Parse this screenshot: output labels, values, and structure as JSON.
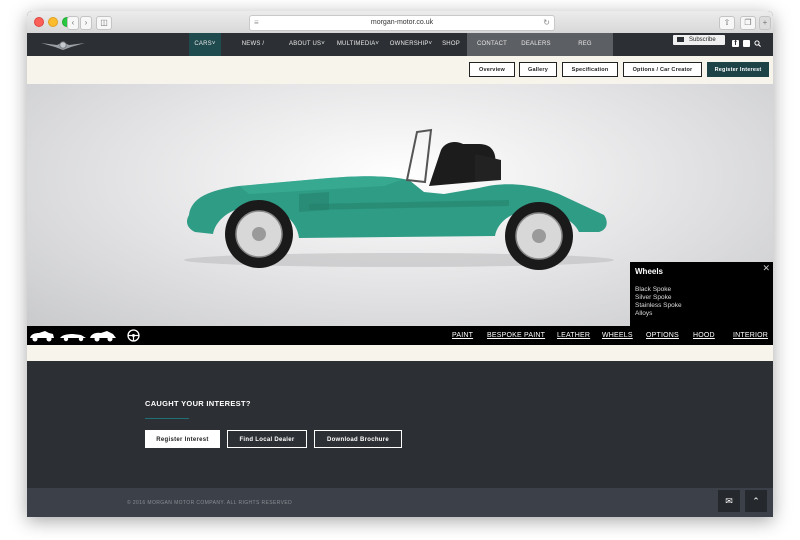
{
  "browser": {
    "url": "morgan-motor.co.uk"
  },
  "nav": {
    "items": [
      "CARS",
      "NEWS / EVENTS",
      "ABOUT US",
      "MULTIMEDIA",
      "OWNERSHIP",
      "SHOP",
      "CONTACT",
      "DEALERS",
      "REG INTEREST"
    ],
    "subscribe": "Subscribe",
    "active_color": "#1f4a4e"
  },
  "subnav": {
    "buttons": [
      "Overview",
      "Gallery",
      "Specification",
      "Options / Car Creator",
      "Register Interest"
    ]
  },
  "wheels_panel": {
    "title": "Wheels",
    "options": [
      "Black Spoke",
      "Silver Spoke",
      "Stainless Spoke",
      "Alloys"
    ]
  },
  "options_bar": {
    "links": [
      "PAINT",
      "BESPOKE PAINT",
      "LEATHER",
      "WHEELS",
      "OPTIONS",
      "HOOD",
      "INTERIOR"
    ]
  },
  "cta": {
    "title": "CAUGHT YOUR INTEREST?",
    "buttons": [
      "Register Interest",
      "Find Local Dealer",
      "Download Brochure"
    ]
  },
  "footer": {
    "copyright": "© 2016 MORGAN MOTOR COMPANY. ALL RIGHTS RESERVED"
  },
  "colors": {
    "car_paint": "#2f9c85",
    "dark": "#2c2f33",
    "accent": "#1d4347"
  }
}
